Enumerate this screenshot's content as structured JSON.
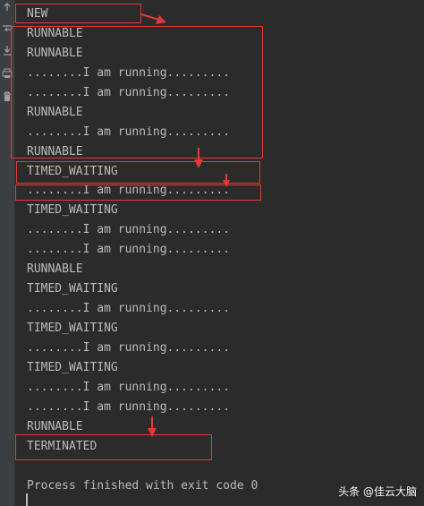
{
  "console": {
    "lines": [
      "NEW",
      "RUNNABLE",
      "RUNNABLE",
      "........I am running.........",
      "........I am running.........",
      "RUNNABLE",
      "........I am running.........",
      "RUNNABLE",
      "TIMED_WAITING",
      "........I am running.........",
      "TIMED_WAITING",
      "........I am running.........",
      "........I am running.........",
      "RUNNABLE",
      "TIMED_WAITING",
      "........I am running.........",
      "TIMED_WAITING",
      "........I am running.........",
      "TIMED_WAITING",
      "........I am running.........",
      "........I am running.........",
      "RUNNABLE",
      "TERMINATED",
      "",
      "Process finished with exit code 0"
    ]
  },
  "gutter": {
    "icons": [
      "scroll-up-icon",
      "soft-wrap-icon",
      "scroll-to-end-icon",
      "print-icon",
      "trash-icon"
    ]
  },
  "watermark": {
    "text": "头条 @佳云大脑"
  },
  "colors": {
    "background": "#2b2b2b",
    "text": "#bbbbbb",
    "annotation": "#e53935",
    "gutter": "#3c3f41"
  }
}
